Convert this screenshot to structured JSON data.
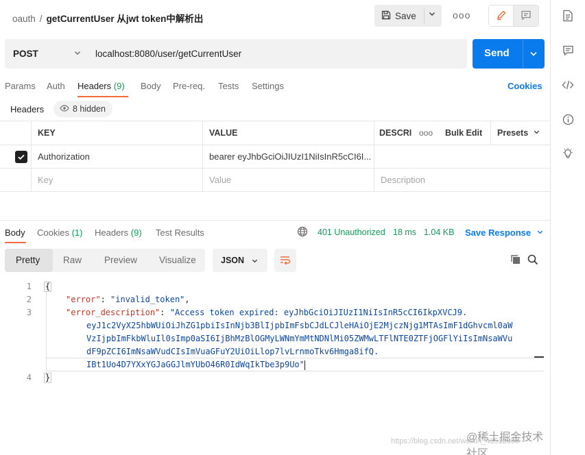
{
  "breadcrumb": {
    "collection": "oauth",
    "separator": "/",
    "request_name": "getCurrentUser 从jwt token中解析出"
  },
  "toolbar": {
    "save_label": "Save",
    "more": "ooo"
  },
  "request": {
    "method": "POST",
    "url": "localhost:8080/user/getCurrentUser",
    "send_label": "Send"
  },
  "request_tabs": [
    {
      "label": "Params"
    },
    {
      "label": "Auth"
    },
    {
      "label": "Headers",
      "count": "(9)"
    },
    {
      "label": "Body"
    },
    {
      "label": "Pre-req."
    },
    {
      "label": "Tests"
    },
    {
      "label": "Settings"
    }
  ],
  "cookies_link": "Cookies",
  "headers_section": {
    "title": "Headers",
    "hidden": "8 hidden"
  },
  "headers_table": {
    "col_key": "KEY",
    "col_value": "VALUE",
    "col_desc": "DESCRI",
    "more": "ooo",
    "bulk_edit": "Bulk Edit",
    "presets": "Presets",
    "rows": [
      {
        "key": "Authorization",
        "value": "bearer eyJhbGciOiJIUzI1NiIsInR5cCI6I...",
        "checked": true
      }
    ],
    "placeholder": {
      "key": "Key",
      "value": "Value",
      "description": "Description"
    }
  },
  "response_tabs": [
    {
      "label": "Body"
    },
    {
      "label": "Cookies",
      "count": "(1)"
    },
    {
      "label": "Headers",
      "count": "(9)"
    },
    {
      "label": "Test Results"
    }
  ],
  "response_meta": {
    "status": "401 Unauthorized",
    "time": "18 ms",
    "size": "1.04 KB",
    "save_response": "Save Response"
  },
  "format_tabs": {
    "pretty": "Pretty",
    "raw": "Raw",
    "preview": "Preview",
    "visualize": "Visualize"
  },
  "format_select": "JSON",
  "code": {
    "line_numbers": [
      "1",
      "2",
      "3",
      "4"
    ],
    "open_brace": "{",
    "close_brace": "}",
    "error_key": "\"error\"",
    "error_value": "\"invalid_token\"",
    "desc_key": "\"error_description\"",
    "desc_lines": [
      "\"Access token expired: eyJhbGciOiJIUzI1NiIsInR5cCI6IkpXVCJ9.",
      "eyJ1c2VyX25hbWUiOiJhZG1pbiIsInNjb3BlIjpbImFsbCJdLCJleHAiOjE2MjczNjg1MTAsImF1dGhvcml0aW",
      "VzIjpbImFkbWluIl0sImp0aSI6IjBhMzBlOGMyLWNmYmMtNDNlMi05ZWMwLTFlNTE0ZTFjOGFlYiIsImNsaWVu",
      "dF9pZCI6ImNsaWVudCIsImVuaGFuY2UiOiLlop7lvLrnmoTkv6Hmga8ifQ.",
      "IBt1Uo4D7YXxYGJaGGJlmYUbO46R0IdWqIkTbe3p9Uo\""
    ]
  },
  "watermark": {
    "text": "@稀土掘金技术社区",
    "url": "https://blog.csdn.net/weixin_43512056"
  }
}
